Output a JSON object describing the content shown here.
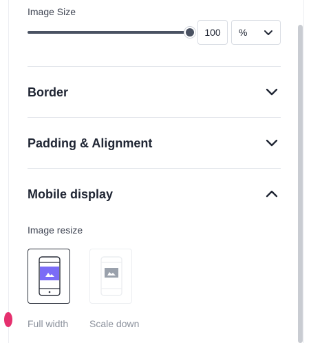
{
  "image_size": {
    "label": "Image Size",
    "slider_percent": 100,
    "value": "100",
    "unit": "%"
  },
  "sections": [
    {
      "title": "Border",
      "state": "collapsed"
    },
    {
      "title": "Padding & Alignment",
      "state": "collapsed"
    },
    {
      "title": "Mobile display",
      "state": "expanded"
    }
  ],
  "mobile": {
    "resize_label": "Image resize",
    "options": [
      {
        "label": "Full width",
        "selected": true
      },
      {
        "label": "Scale down",
        "selected": false
      }
    ]
  },
  "colors": {
    "accent_purple": "#7b6cf6",
    "slider": "#4a5262",
    "indicator_pink": "#e5306e"
  }
}
